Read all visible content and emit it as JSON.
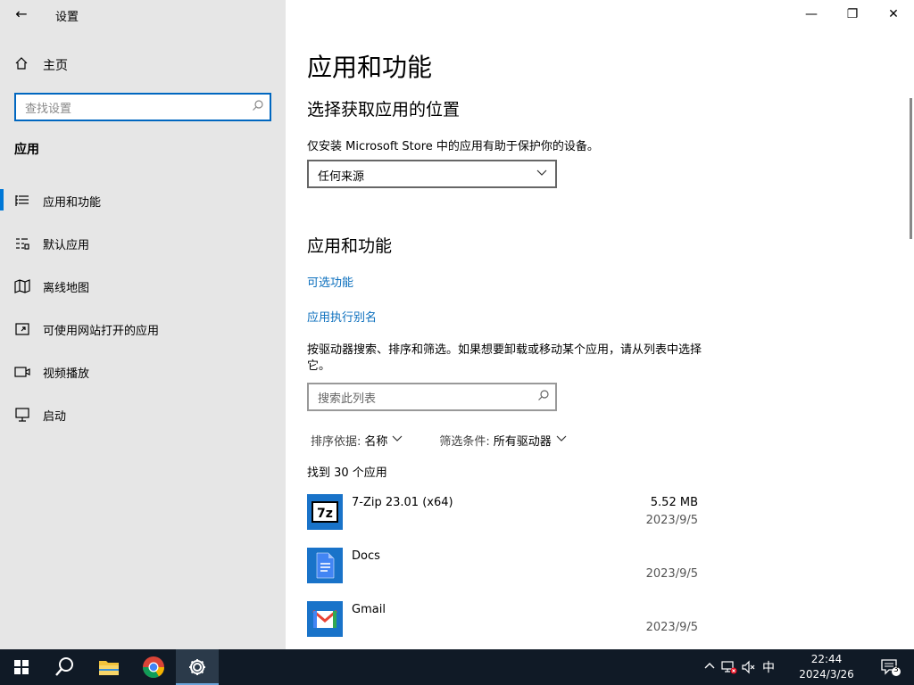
{
  "window": {
    "title": "设置",
    "back_label": "←",
    "controls": {
      "minimize": "—",
      "restore": "❐",
      "close": "✕"
    }
  },
  "sidebar": {
    "home_label": "主页",
    "search_placeholder": "查找设置",
    "section_title": "应用",
    "items": [
      {
        "label": "应用和功能",
        "active": true
      },
      {
        "label": "默认应用"
      },
      {
        "label": "离线地图"
      },
      {
        "label": "可使用网站打开的应用"
      },
      {
        "label": "视频播放"
      },
      {
        "label": "启动"
      }
    ]
  },
  "main": {
    "title": "应用和功能",
    "location": {
      "heading": "选择获取应用的位置",
      "description": "仅安装 Microsoft Store 中的应用有助于保护你的设备。",
      "dropdown_value": "任何来源"
    },
    "features": {
      "heading": "应用和功能",
      "link_optional": "可选功能",
      "link_alias": "应用执行别名",
      "paragraph": "按驱动器搜索、排序和筛选。如果想要卸载或移动某个应用，请从列表中选择它。",
      "search_placeholder": "搜索此列表",
      "sort_key": "排序依据:",
      "sort_value": "名称",
      "filter_key": "筛选条件:",
      "filter_value": "所有驱动器",
      "found": "找到 30 个应用"
    },
    "apps": [
      {
        "name": "7-Zip 23.01 (x64)",
        "size": "5.52 MB",
        "date": "2023/9/5",
        "icon": "7zip-icon"
      },
      {
        "name": "Docs",
        "size": "",
        "date": "2023/9/5",
        "icon": "docs-icon"
      },
      {
        "name": "Gmail",
        "size": "",
        "date": "2023/9/5",
        "icon": "gmail-icon"
      }
    ]
  },
  "taskbar": {
    "time": "22:44",
    "date": "2024/3/26",
    "ime": "中",
    "notification_count": "3",
    "accent": "#0078d7"
  }
}
